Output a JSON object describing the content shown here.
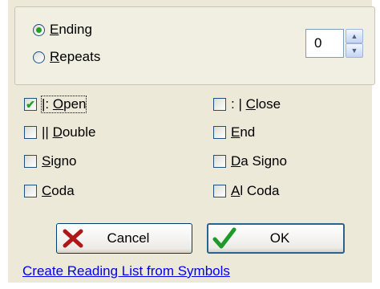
{
  "repeat_group": {
    "ending": {
      "label_accel": "E",
      "label_rest": "nding",
      "selected": true
    },
    "repeats": {
      "label_accel": "R",
      "label_rest": "epeats",
      "selected": false
    },
    "count_value": "0"
  },
  "options": {
    "open": {
      "prefix": "|: ",
      "accel": "O",
      "rest": "pen",
      "checked": true
    },
    "close": {
      "prefix": ": | ",
      "accel": "C",
      "rest": "lose",
      "checked": false
    },
    "double": {
      "prefix": "|| ",
      "accel": "D",
      "rest": "ouble",
      "checked": false
    },
    "end": {
      "prefix": "",
      "accel": "E",
      "rest": "nd",
      "checked": false
    },
    "signo": {
      "prefix": "",
      "accel": "S",
      "rest": "igno",
      "checked": false
    },
    "da_signo": {
      "prefix": "",
      "accel": "D",
      "rest": "a Signo",
      "checked": false
    },
    "coda": {
      "prefix": "",
      "accel": "C",
      "rest": "oda",
      "checked": false
    },
    "al_coda": {
      "prefix": "",
      "accel": "A",
      "rest": "l Coda",
      "checked": false
    }
  },
  "buttons": {
    "cancel": {
      "label": "Cancel",
      "icon": "x-icon",
      "icon_color": "#b01818"
    },
    "ok": {
      "label": "OK",
      "icon": "checkmark-icon",
      "icon_color": "#1f9a2a"
    }
  },
  "link": {
    "text": "Create Reading List from Symbols",
    "color": "#0000ee"
  },
  "colors": {
    "panel": "#ece9d8",
    "check_green": "#21a121"
  }
}
